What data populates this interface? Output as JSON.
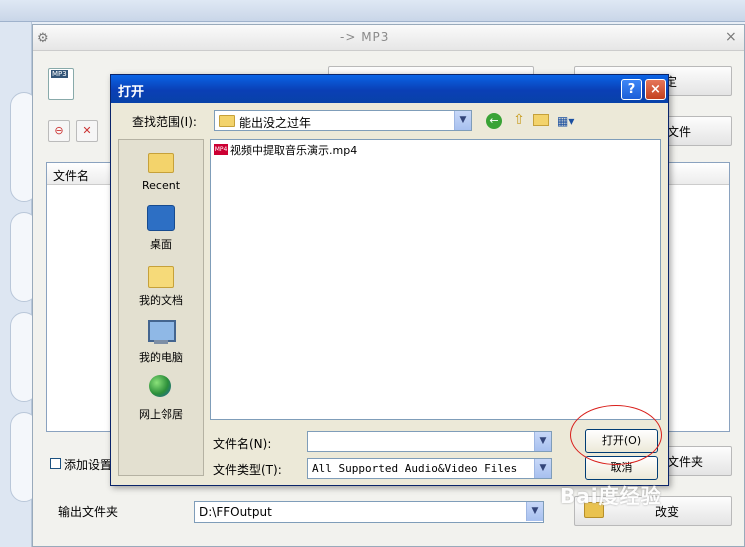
{
  "background": {
    "window_title": "-> MP3",
    "right_button_1": "定",
    "right_button_2": "文件",
    "list_column_filename": "文件名",
    "add_setting_checkbox": "添加设置",
    "right_button_3": "文件夹",
    "output_folder_label": "输出文件夹",
    "output_folder_value": "D:\\FFOutput",
    "change_button": "改变",
    "close_glyph": "×"
  },
  "dialog": {
    "title": "打开",
    "help_glyph": "?",
    "close_glyph": "×",
    "look_in_label": "查找范围(I):",
    "look_in_value": "能出没之过年",
    "places": [
      {
        "label": "Recent"
      },
      {
        "label": "桌面"
      },
      {
        "label": "我的文档"
      },
      {
        "label": "我的电脑"
      },
      {
        "label": "网上邻居"
      }
    ],
    "files": [
      {
        "name": "视频中提取音乐演示.mp4",
        "badge": "MP4"
      }
    ],
    "filename_label": "文件名(N):",
    "filename_value": "",
    "filetype_label": "文件类型(T):",
    "filetype_value": "All Supported Audio&Video Files",
    "open_button": "打开(O)",
    "cancel_button": "取消"
  },
  "watermark": "Bai度经验"
}
